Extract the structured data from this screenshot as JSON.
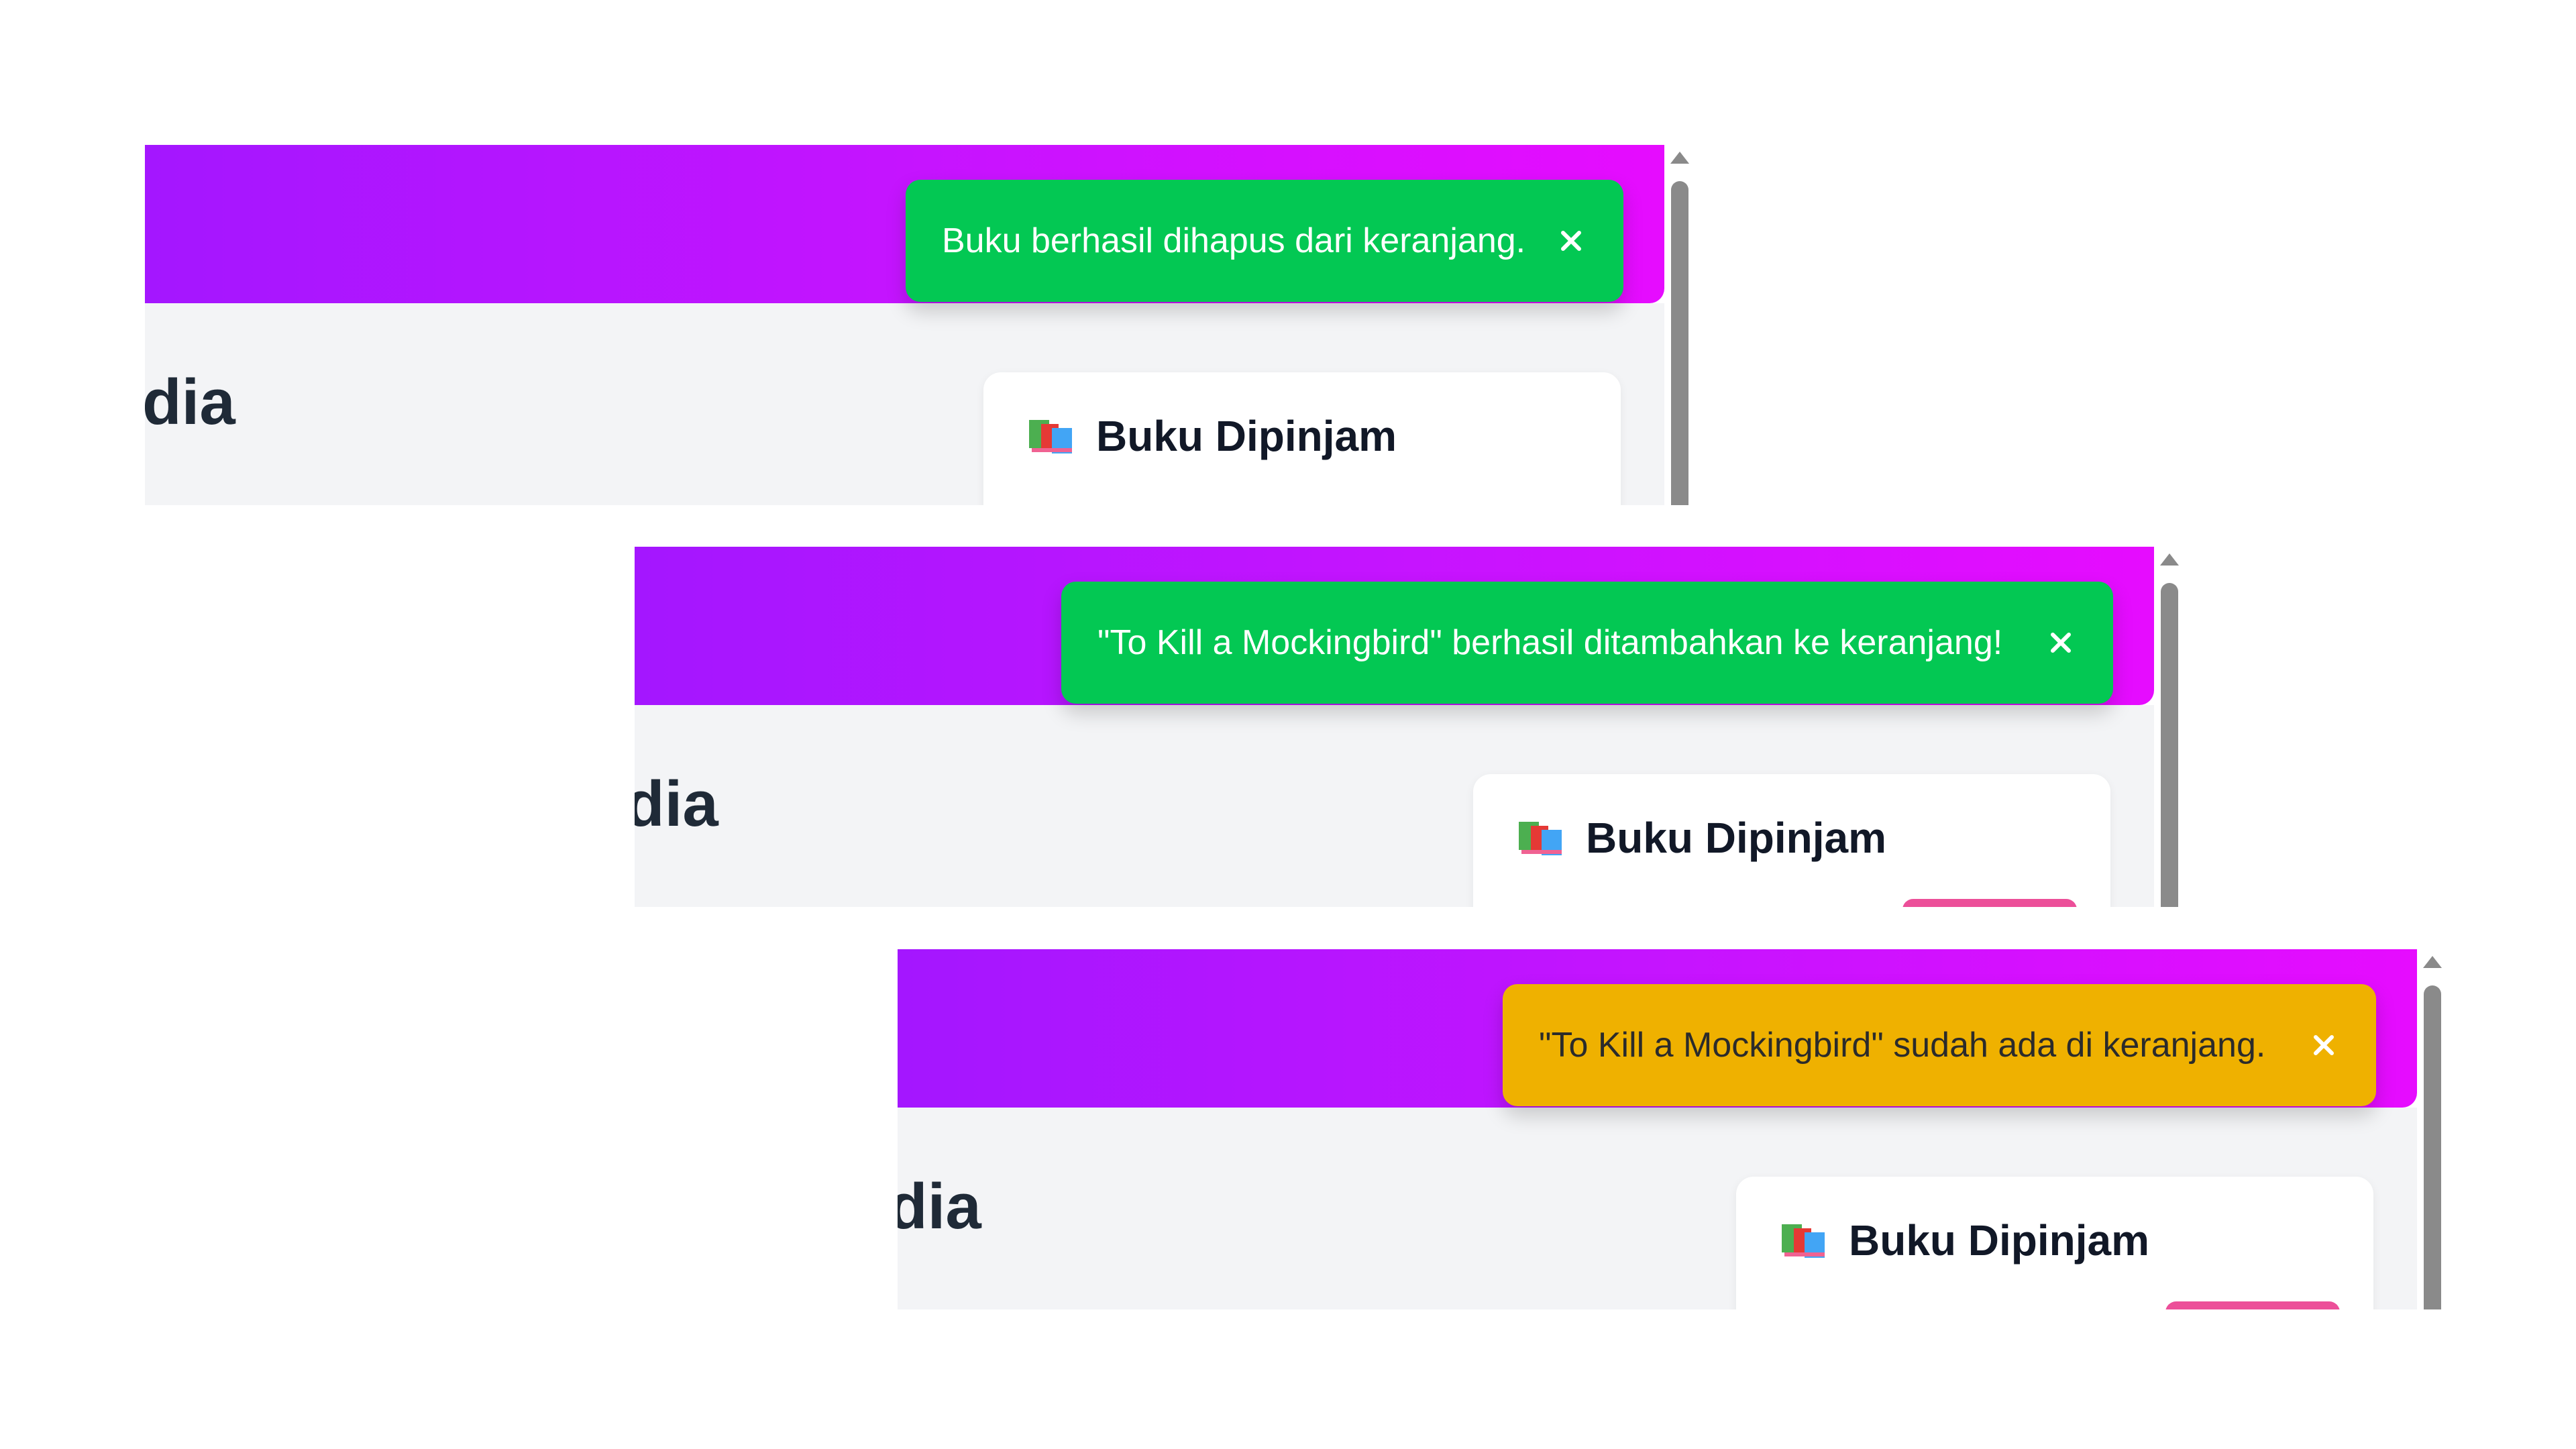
{
  "header_gradient": [
    "#a416ff",
    "#e60cff"
  ],
  "colors": {
    "success": "#03c853",
    "warning": "#efb100",
    "content_bg": "#f3f4f6",
    "accent_pink": "#ec4f99"
  },
  "panels": [
    {
      "page_title": "dia",
      "toast": {
        "type": "success",
        "message": "Buku berhasil dihapus dari keranjang.",
        "close_label": "×"
      },
      "card": {
        "icon": "books-icon",
        "title": "Buku Dipinjam"
      }
    },
    {
      "page_title": "dia",
      "toast": {
        "type": "success",
        "message": "\"To Kill a Mockingbird\" berhasil ditambahkan ke keranjang!",
        "close_label": "×"
      },
      "card": {
        "icon": "books-icon",
        "title": "Buku Dipinjam"
      }
    },
    {
      "page_title": "dia",
      "toast": {
        "type": "warning",
        "message": "\"To Kill a Mockingbird\" sudah ada di keranjang.",
        "close_label": "×"
      },
      "card": {
        "icon": "books-icon",
        "title": "Buku Dipinjam"
      }
    }
  ]
}
